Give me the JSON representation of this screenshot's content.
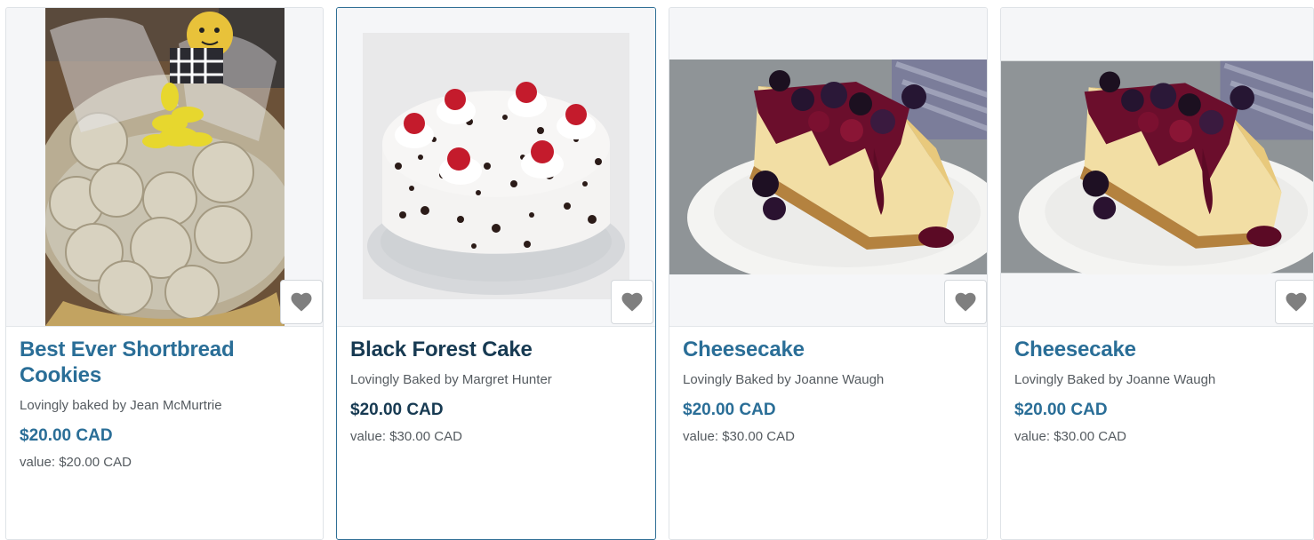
{
  "products": [
    {
      "title": "Best Ever Shortbread Cookies",
      "baker": "Lovingly baked by Jean McMurtrie",
      "price": "$20.00 CAD",
      "value": "value: $20.00 CAD",
      "favorite_icon": "heart-icon"
    },
    {
      "title": "Black Forest Cake",
      "baker": "Lovingly Baked by Margret Hunter",
      "price": "$20.00 CAD",
      "value": "value: $30.00 CAD",
      "favorite_icon": "heart-icon"
    },
    {
      "title": "Cheesecake",
      "baker": "Lovingly Baked by Joanne Waugh",
      "price": "$20.00 CAD",
      "value": "value: $30.00 CAD",
      "favorite_icon": "heart-icon"
    },
    {
      "title": "Cheesecake",
      "baker": "Lovingly Baked by Joanne Waugh",
      "price": "$20.00 CAD",
      "value": "value: $30.00 CAD",
      "favorite_icon": "heart-icon"
    }
  ],
  "colors": {
    "title_accent": "#2a6e97",
    "title_dark": "#173a52",
    "text_muted": "#555b60",
    "active_border": "#2f6f95"
  }
}
